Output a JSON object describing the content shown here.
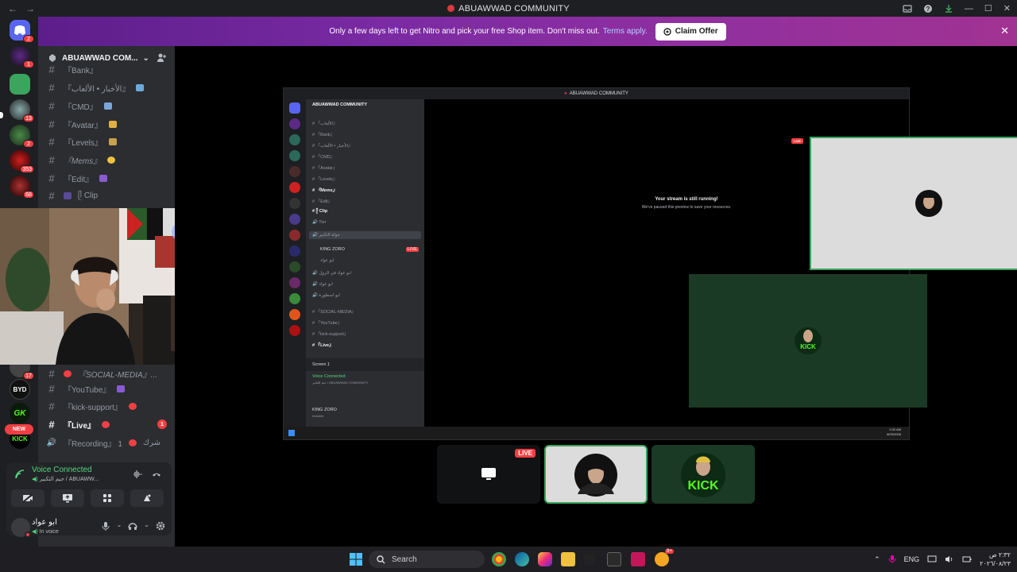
{
  "app": {
    "title": "ABUAWWAD COMMUNITY",
    "nav_back": "←",
    "nav_forward": "→",
    "window_controls": [
      "—",
      "☐",
      "✕"
    ]
  },
  "banner": {
    "text": "Only a few days left to get Nitro and pick your free Shop item. Don't miss out.",
    "terms": "Terms apply.",
    "cta": "Claim Offer",
    "close": "✕"
  },
  "servers": {
    "badges": [
      "2",
      "1",
      "13",
      "2",
      "353",
      "68",
      "17"
    ],
    "new_label": "NEW"
  },
  "guild": {
    "name": "ABUAWWAD COM...",
    "chevron": "⌄"
  },
  "channels": [
    {
      "icon": "#",
      "label": "『Bank』",
      "unread": ""
    },
    {
      "icon": "#",
      "label": "『الأخبار • الألعاب』",
      "unread": ""
    },
    {
      "icon": "#",
      "label": "『CMD』",
      "unread": ""
    },
    {
      "icon": "#",
      "label": "『Avatar』",
      "unread": ""
    },
    {
      "icon": "#",
      "label": "『Levels』",
      "unread": ""
    },
    {
      "icon": "#",
      "label": "『Mems』",
      "unread": ""
    },
    {
      "icon": "#",
      "label": "『Edit』",
      "unread": ""
    },
    {
      "icon": "#",
      "label": "ᥫ Clip",
      "unread": ""
    }
  ],
  "channels_lower": [
    {
      "icon": "#",
      "label": "『SOCIAL-MEDIA』...",
      "unread": ""
    },
    {
      "icon": "#",
      "label": "『YouTube』",
      "unread": ""
    },
    {
      "icon": "#",
      "label": "『kick-support』",
      "unread": ""
    },
    {
      "icon": "#",
      "label": "『Live』",
      "unread": "1"
    },
    {
      "icon": "🔊",
      "label": "『Recording』 1",
      "unread": ""
    }
  ],
  "channels_lower_tail": "شرك",
  "voice": {
    "status": "Voice Connected",
    "channel": "جيم التكبير / ABUAWW...",
    "buttons": [
      "camera-off",
      "screen-share",
      "activities",
      "soundboard"
    ]
  },
  "user": {
    "name": "ابو عواد",
    "status": "In voice"
  },
  "stream": {
    "title": "ABUAWWAD COMMUNITY",
    "paused_title": "Your stream is still running!",
    "paused_sub": "We've paused this preview to save your resources.",
    "live": "LIVE",
    "inner_guild": "ABUAWWAD COMMUNITY",
    "inner_channels": [
      "『الألعاب』",
      "『Bank』",
      "『الأخبار • الألعاب』",
      "『CMD』",
      "『Avatar』",
      "『Levels』",
      "『Mems』",
      "『Edit』",
      "ᥫ Clip",
      "Tier",
      "جولة التكبير",
      "KING ZORO",
      "ابو عواد",
      "ابو عواد في الرول",
      "ابو عواد",
      "ابو اسطورة",
      "『SOCIAL-MEDIA』",
      "『YouTube』",
      "『kick-support』",
      "『Live』"
    ],
    "inner_screen": "Screen 1",
    "inner_voice": "Voice Connected",
    "inner_voice_sub": "جيم التكبير / ABUAWWAD COMMUNITY",
    "inner_user": "KING ZORO",
    "inner_user_status": "Invisible",
    "inner_time": "2:32 AM",
    "inner_date": "8/23/2026",
    "inner_live": "LIVE",
    "inner_username_tile": "KING ZORO"
  },
  "tiles": {
    "live": "LIVE"
  },
  "taskbar": {
    "search": "Search",
    "lang": "ENG",
    "time": "٢:٣٢ ص",
    "date": "٢٠٢٦/٠٨/٢٣"
  }
}
